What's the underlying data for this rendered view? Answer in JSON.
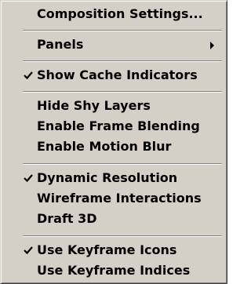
{
  "menu": {
    "items": [
      {
        "label": "Composition Settings..."
      },
      {
        "label": "Panels",
        "submenu": true
      },
      {
        "label": "Show Cache Indicators",
        "checked": true
      },
      {
        "label": "Hide Shy Layers"
      },
      {
        "label": "Enable Frame Blending"
      },
      {
        "label": "Enable Motion Blur"
      },
      {
        "label": "Dynamic Resolution",
        "checked": true
      },
      {
        "label": "Wireframe Interactions"
      },
      {
        "label": "Draft 3D"
      },
      {
        "label": "Use Keyframe Icons",
        "checked": true
      },
      {
        "label": "Use Keyframe Indices"
      }
    ],
    "check_icon": "checkmark-icon",
    "submenu_icon": "submenu-arrow-icon"
  }
}
